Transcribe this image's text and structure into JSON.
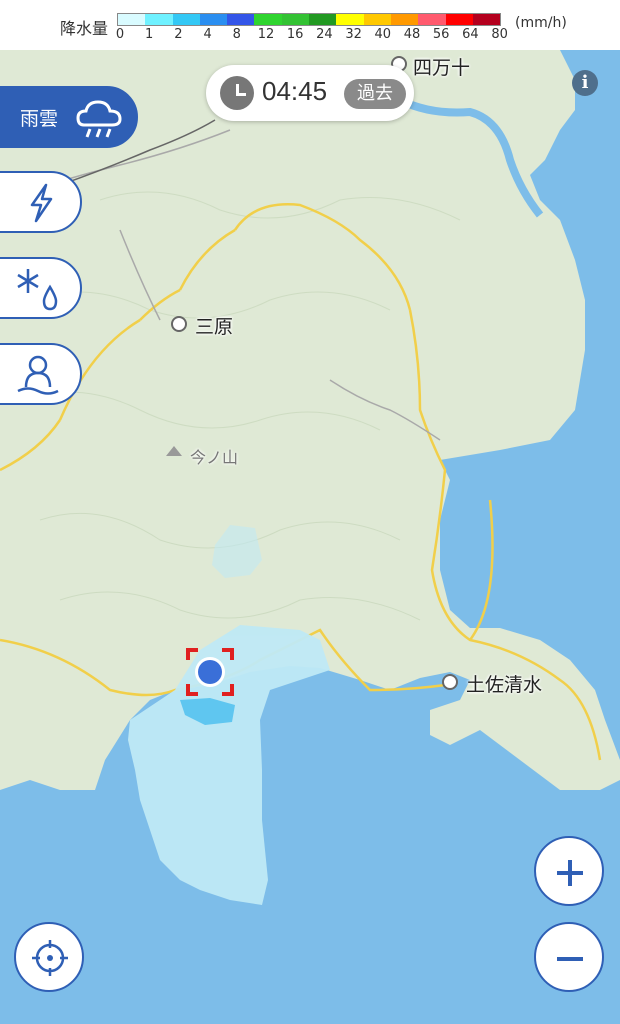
{
  "legend": {
    "title": "降水量",
    "unit": "(mm/h)",
    "ticks": [
      "0",
      "1",
      "2",
      "4",
      "8",
      "12",
      "16",
      "24",
      "32",
      "40",
      "48",
      "56",
      "64",
      "80"
    ],
    "colors": [
      "#d9fbff",
      "#6ff1ff",
      "#33c8f5",
      "#2a8ef0",
      "#3355e8",
      "#2fd42f",
      "#33c233",
      "#229922",
      "#ffff00",
      "#ffc800",
      "#ff9900",
      "#ff5a6e",
      "#ff0000",
      "#b4001e"
    ]
  },
  "time": {
    "value": "04:45",
    "past_label": "過去",
    "icon": "clock-icon"
  },
  "layers": [
    {
      "label": "雨雲",
      "icon": "rain-cloud-icon",
      "active": true
    },
    {
      "label": "",
      "icon": "lightning-icon",
      "active": false
    },
    {
      "label": "",
      "icon": "snow-icon",
      "active": false
    },
    {
      "label": "",
      "icon": "snowman-icon",
      "active": false
    }
  ],
  "places": {
    "shimanto": "四万十",
    "mihara": "三原",
    "imanoyama": "今ノ山",
    "tosashimizu": "土佐清水"
  },
  "controls": {
    "zoom_in": "+",
    "zoom_out": "−",
    "info": "i",
    "locate": "locate-icon"
  },
  "colors": {
    "accent": "#2f5fb5",
    "land": "#dfe9d5",
    "sea": "#7dbde9",
    "road": "#f1cf4a",
    "rain_light": "#bfe9f5",
    "rain_medium": "#5fc6f0"
  }
}
